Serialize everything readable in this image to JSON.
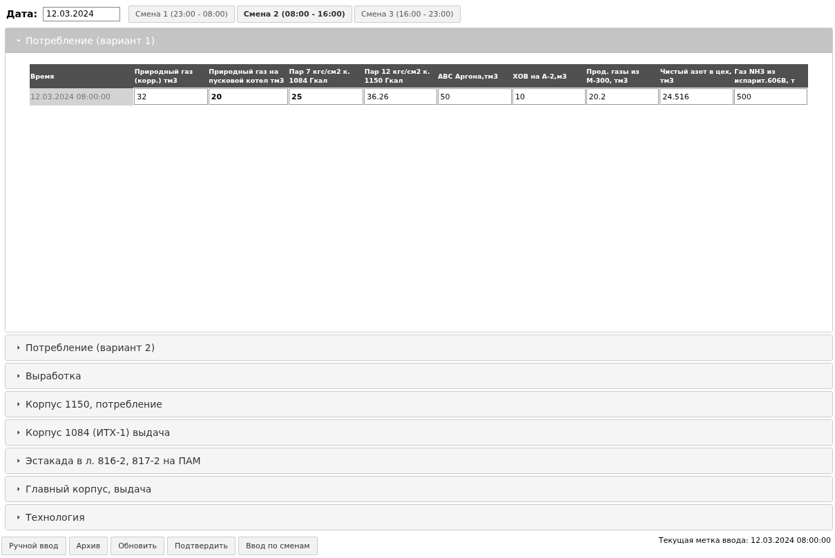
{
  "date": {
    "label": "Дата:",
    "value": "12.03.2024"
  },
  "shifts": [
    {
      "label": "Смена 1 (23:00 - 08:00)",
      "selected": false
    },
    {
      "label": "Смена 2 (08:00 - 16:00)",
      "selected": true
    },
    {
      "label": "Смена 3 (16:00 - 23:00)",
      "selected": false
    }
  ],
  "sections": [
    {
      "title": "Потребление (вариант 1)",
      "expanded": true,
      "table": {
        "columns": [
          "Время",
          "Природный газ (корр.) тм3",
          "Природный газ на пусковой котел тм3",
          "Пар 7 кгс/см2 к. 1084 Гкал",
          "Пар 12 кгс/см2 к. 1150 Гкал",
          "АВС Аргона,тм3",
          "ХОВ на А-2,м3",
          "Прод. газы из М-300, тм3",
          "Чистый азот в цех, тм3",
          "Газ NH3 из испарит.606В, т"
        ],
        "rows": [
          {
            "cells": [
              {
                "kind": "time",
                "value": "12.03.2024 08:00:00"
              },
              {
                "kind": "input",
                "value": "32",
                "bold": false
              },
              {
                "kind": "input",
                "value": "20",
                "bold": true
              },
              {
                "kind": "input",
                "value": "25",
                "bold": true
              },
              {
                "kind": "input",
                "value": "36.26",
                "bold": false
              },
              {
                "kind": "input",
                "value": "50",
                "bold": false
              },
              {
                "kind": "input",
                "value": "10",
                "bold": false
              },
              {
                "kind": "input",
                "value": "20.2",
                "bold": false
              },
              {
                "kind": "input",
                "value": "24.516",
                "bold": false
              },
              {
                "kind": "input",
                "value": "500",
                "bold": false
              }
            ]
          }
        ]
      }
    },
    {
      "title": "Потребление (вариант 2)",
      "expanded": false
    },
    {
      "title": "Выработка",
      "expanded": false
    },
    {
      "title": "Корпус 1150, потребление",
      "expanded": false
    },
    {
      "title": "Корпус 1084 (ИТХ-1) выдача",
      "expanded": false
    },
    {
      "title": "Эстакада в л. 816-2, 817-2 на ПАМ",
      "expanded": false
    },
    {
      "title": "Главный корпус, выдача",
      "expanded": false
    },
    {
      "title": "Технология",
      "expanded": false
    }
  ],
  "buttons": [
    "Ручной ввод",
    "Архив",
    "Обновить",
    "Подтвердить",
    "Ввод по сменам"
  ],
  "status": "Текущая метка ввода: 12.03.2024 08:00:00"
}
